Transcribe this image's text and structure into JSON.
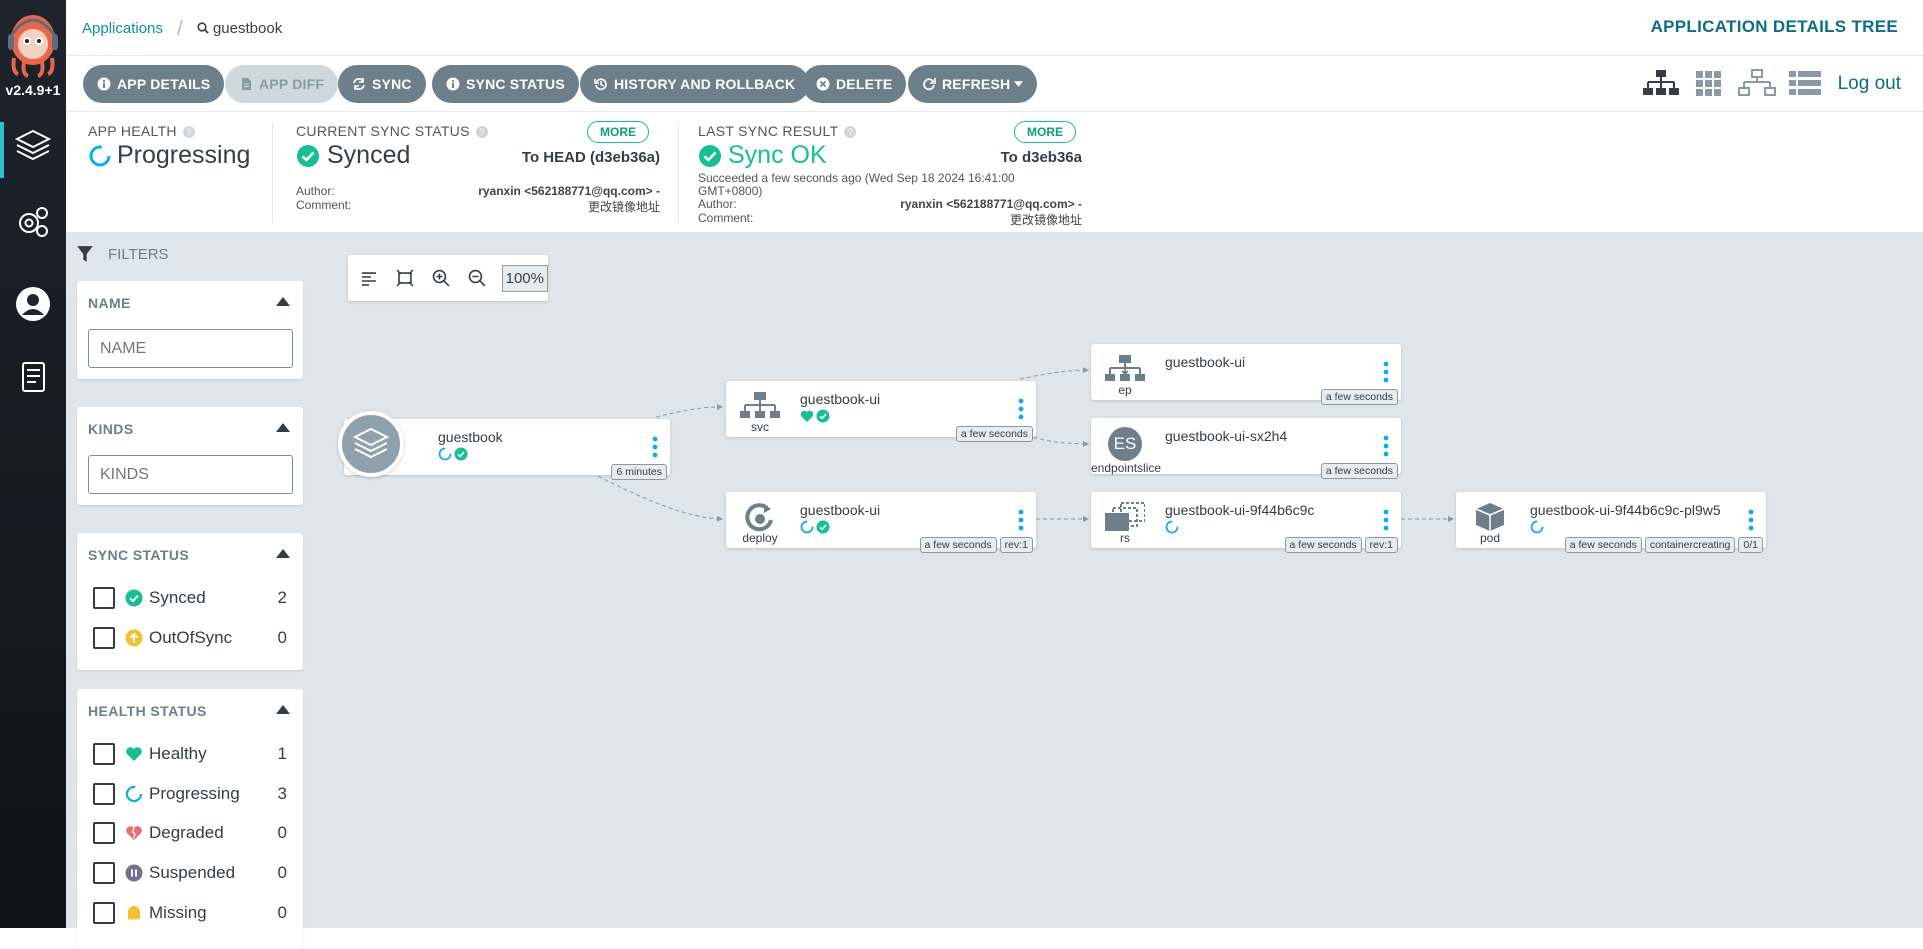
{
  "sidebar": {
    "version": "v2.4.9+1",
    "items": [
      {
        "name": "applications"
      },
      {
        "name": "settings"
      },
      {
        "name": "user-info"
      },
      {
        "name": "documentation"
      }
    ]
  },
  "breadcrumb": {
    "root": "Applications",
    "current": "guestbook"
  },
  "page_title": "APPLICATION DETAILS TREE",
  "toolbar": {
    "buttons": [
      {
        "label": "APP DETAILS",
        "icon": "info-icon"
      },
      {
        "label": "APP DIFF",
        "icon": "file-icon"
      },
      {
        "label": "SYNC",
        "icon": "sync-icon"
      },
      {
        "label": "SYNC STATUS",
        "icon": "info-icon"
      },
      {
        "label": "HISTORY AND ROLLBACK",
        "icon": "history-icon"
      },
      {
        "label": "DELETE",
        "icon": "times-circle-icon"
      },
      {
        "label": "REFRESH",
        "icon": "redo-icon"
      }
    ],
    "logout": "Log out"
  },
  "summary": {
    "app_health": {
      "label": "APP HEALTH",
      "value": "Progressing"
    },
    "current_sync": {
      "label": "CURRENT SYNC STATUS",
      "more": "MORE",
      "value": "Synced",
      "target": "To HEAD (d3eb36a)",
      "author_label": "Author:",
      "author": "ryanxin <562188771@qq.com> -",
      "comment_label": "Comment:",
      "comment": "更改镜像地址"
    },
    "last_sync": {
      "label": "LAST SYNC RESULT",
      "more": "MORE",
      "value": "Sync OK",
      "target": "To d3eb36a",
      "succeeded": "Succeeded a few seconds ago (Wed Sep 18 2024 16:41:00",
      "tz": "GMT+0800)",
      "author_label": "Author:",
      "author": "ryanxin <562188771@qq.com> -",
      "comment_label": "Comment:",
      "comment": "更改镜像地址"
    }
  },
  "filters": {
    "title": "FILTERS",
    "name": {
      "header": "NAME",
      "placeholder": "NAME"
    },
    "kinds": {
      "header": "KINDS",
      "placeholder": "KINDS"
    },
    "sync_status": {
      "header": "SYNC STATUS",
      "items": [
        {
          "label": "Synced",
          "count": "2",
          "color": "#18be94"
        },
        {
          "label": "OutOfSync",
          "count": "0",
          "color": "#f4c030"
        }
      ]
    },
    "health_status": {
      "header": "HEALTH STATUS",
      "items": [
        {
          "label": "Healthy",
          "count": "1",
          "color": "#18be94"
        },
        {
          "label": "Progressing",
          "count": "3",
          "color": "#0dadea"
        },
        {
          "label": "Degraded",
          "count": "0",
          "color": "#e96d76"
        },
        {
          "label": "Suspended",
          "count": "0",
          "color": "#766f94"
        },
        {
          "label": "Missing",
          "count": "0",
          "color": "#f4c030"
        }
      ]
    }
  },
  "canvas": {
    "zoom": "100%",
    "nodes": {
      "app": {
        "name": "guestbook",
        "tags": [
          "6 minutes"
        ]
      },
      "svc": {
        "name": "guestbook-ui",
        "kind": "svc",
        "tags": [
          "a few seconds"
        ]
      },
      "ep": {
        "name": "guestbook-ui",
        "kind": "ep",
        "tags": [
          "a few seconds"
        ]
      },
      "es": {
        "name": "guestbook-ui-sx2h4",
        "kind": "endpointslice",
        "badge": "ES",
        "tags": [
          "a few seconds"
        ]
      },
      "deploy": {
        "name": "guestbook-ui",
        "kind": "deploy",
        "tags": [
          "a few seconds",
          "rev:1"
        ]
      },
      "rs": {
        "name": "guestbook-ui-9f44b6c9c",
        "kind": "rs",
        "tags": [
          "a few seconds",
          "rev:1"
        ]
      },
      "pod": {
        "name": "guestbook-ui-9f44b6c9c-pl9w5",
        "kind": "pod",
        "tags": [
          "a few seconds",
          "containercreating",
          "0/1"
        ]
      }
    }
  }
}
